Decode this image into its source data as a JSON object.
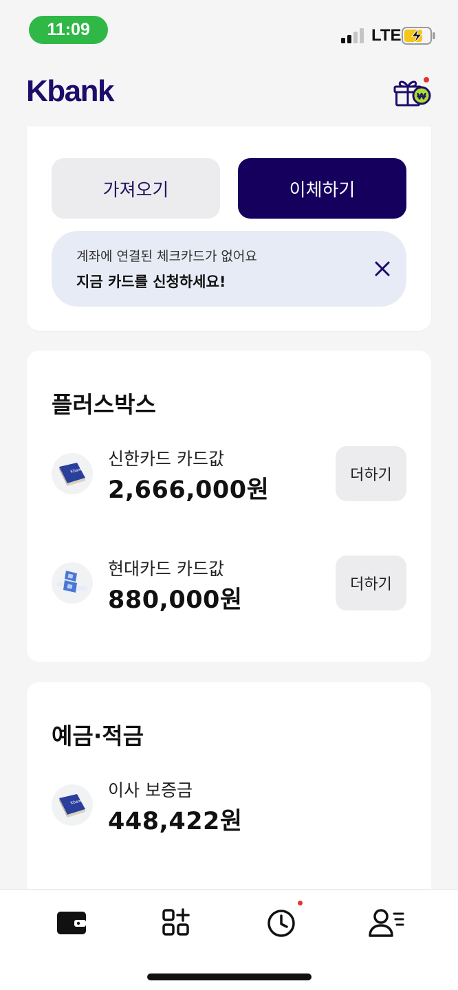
{
  "status_bar": {
    "time": "11:09",
    "network": "LTE"
  },
  "header": {
    "logo": "Kbank"
  },
  "account_actions": {
    "fetch_label": "가져오기",
    "transfer_label": "이체하기"
  },
  "notice": {
    "subtitle": "계좌에 연결된 체크카드가 없어요",
    "title": "지금 카드를 신청하세요!"
  },
  "plus_box": {
    "title": "플러스박스",
    "items": [
      {
        "label": "신한카드 카드값",
        "amount": "2,666,000원",
        "button": "더하기",
        "icon": "card-book-icon"
      },
      {
        "label": "현대카드 카드값",
        "amount": "880,000원",
        "button": "더하기",
        "icon": "money-stack-icon"
      }
    ]
  },
  "deposits": {
    "title": "예금·적금",
    "items": [
      {
        "label": "이사 보증금",
        "amount": "448,422원",
        "icon": "card-book-icon"
      }
    ]
  },
  "bottom_nav": {
    "items": [
      "wallet-icon",
      "apps-add-icon",
      "history-clock-icon",
      "profile-menu-icon"
    ]
  },
  "colors": {
    "brand": "#1e0c6b",
    "primary_button": "#15005e",
    "status_pill": "#2fb846",
    "notice_bg": "#e7ebf5",
    "badge_red": "#e8322b"
  }
}
